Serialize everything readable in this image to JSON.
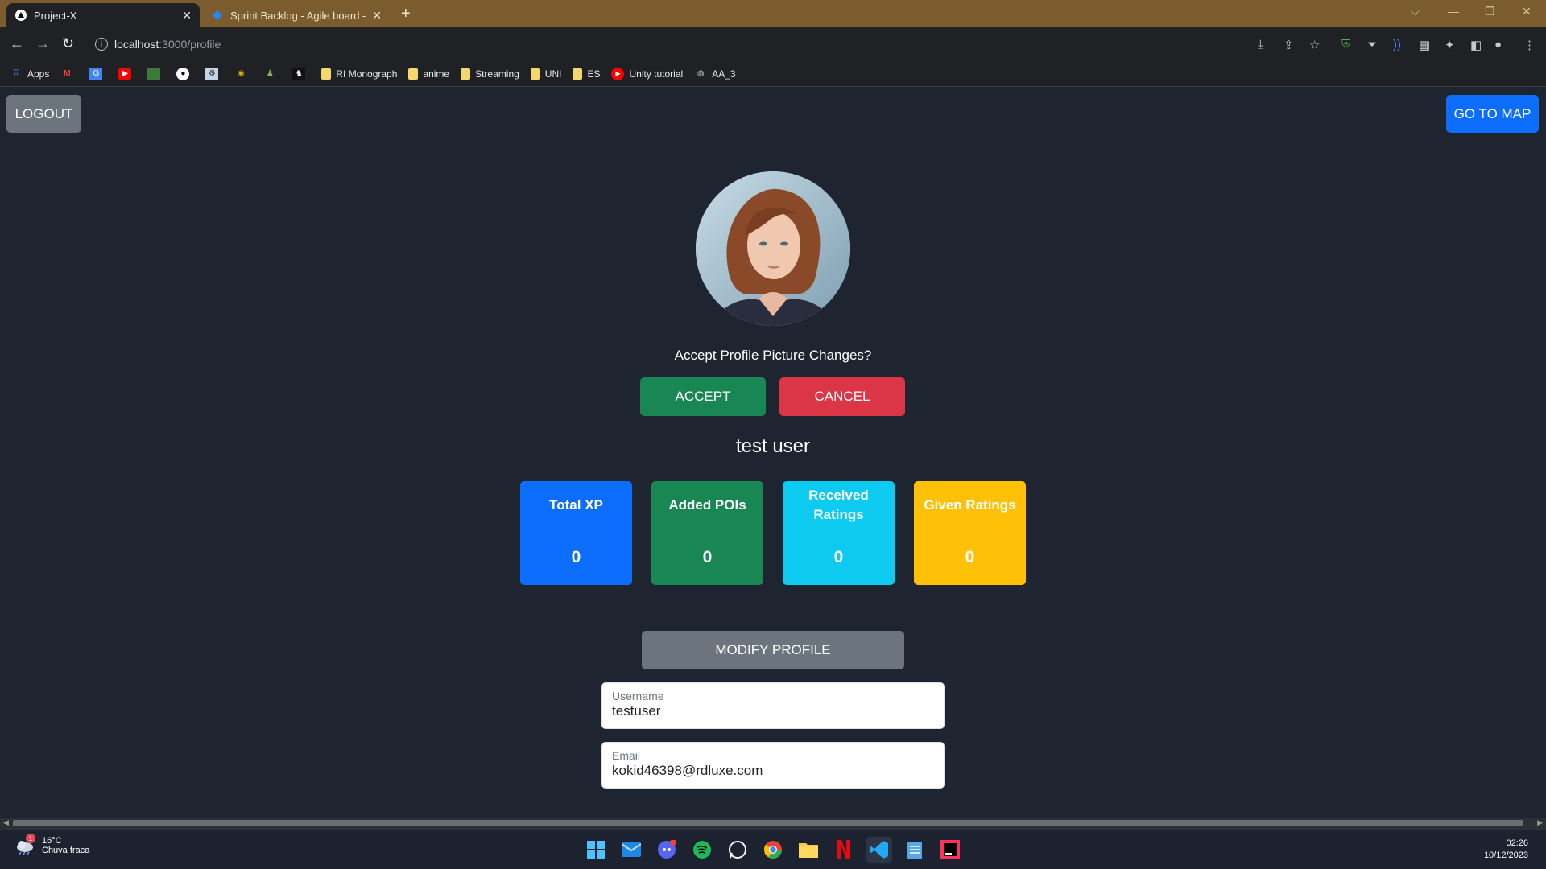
{
  "browser": {
    "tabs": [
      {
        "title": "Project-X",
        "active": true
      },
      {
        "title": "Sprint Backlog - Agile board - Ji",
        "active": false
      }
    ],
    "url_host": "localhost",
    "url_path": ":3000/profile",
    "bookmarks": [
      {
        "label": "Apps",
        "icon": "apps-grid-icon"
      },
      {
        "label": "",
        "icon": "gmail-icon"
      },
      {
        "label": "",
        "icon": "translate-icon"
      },
      {
        "label": "",
        "icon": "youtube-icon"
      },
      {
        "label": "",
        "icon": "calendar-icon"
      },
      {
        "label": "",
        "icon": "github-icon"
      },
      {
        "label": "",
        "icon": "steam-icon"
      },
      {
        "label": "",
        "icon": "app-icon"
      },
      {
        "label": "",
        "icon": "chess-icon"
      },
      {
        "label": "",
        "icon": "lichess-icon"
      },
      {
        "label": "RI Monograph",
        "icon": "folder-icon"
      },
      {
        "label": "anime",
        "icon": "folder-icon"
      },
      {
        "label": "Streaming",
        "icon": "folder-icon"
      },
      {
        "label": "UNI",
        "icon": "folder-icon"
      },
      {
        "label": "ES",
        "icon": "folder-icon"
      },
      {
        "label": "Unity tutorial",
        "icon": "youtube-icon"
      },
      {
        "label": "AA_3",
        "icon": "globe-icon"
      }
    ]
  },
  "page": {
    "logout_label": "LOGOUT",
    "go_to_map_label": "GO TO MAP",
    "prompt": "Accept Profile Picture Changes?",
    "accept_label": "ACCEPT",
    "cancel_label": "CANCEL",
    "display_name": "test user",
    "stats": [
      {
        "label": "Total XP",
        "value": "0",
        "color": "#0d6efd"
      },
      {
        "label": "Added POIs",
        "value": "0",
        "color": "#198754"
      },
      {
        "label": "Received Ratings",
        "value": "0",
        "color": "#0dcaf0"
      },
      {
        "label": "Given Ratings",
        "value": "0",
        "color": "#ffc107"
      }
    ],
    "modify_label": "MODIFY PROFILE",
    "username_label": "Username",
    "username_value": "testuser",
    "email_label": "Email",
    "email_value": "kokid46398@rdluxe.com"
  },
  "taskbar": {
    "weather_temp": "16°C",
    "weather_desc": "Chuva fraca",
    "weather_badge": "1",
    "time": "02:26",
    "date": "10/12/2023",
    "apps": [
      "windows-start-icon",
      "mail-icon",
      "discord-icon",
      "spotify-icon",
      "whatsapp-icon",
      "chrome-icon",
      "file-explorer-icon",
      "netflix-icon",
      "vscode-icon",
      "notepad-icon",
      "intellij-icon"
    ]
  }
}
